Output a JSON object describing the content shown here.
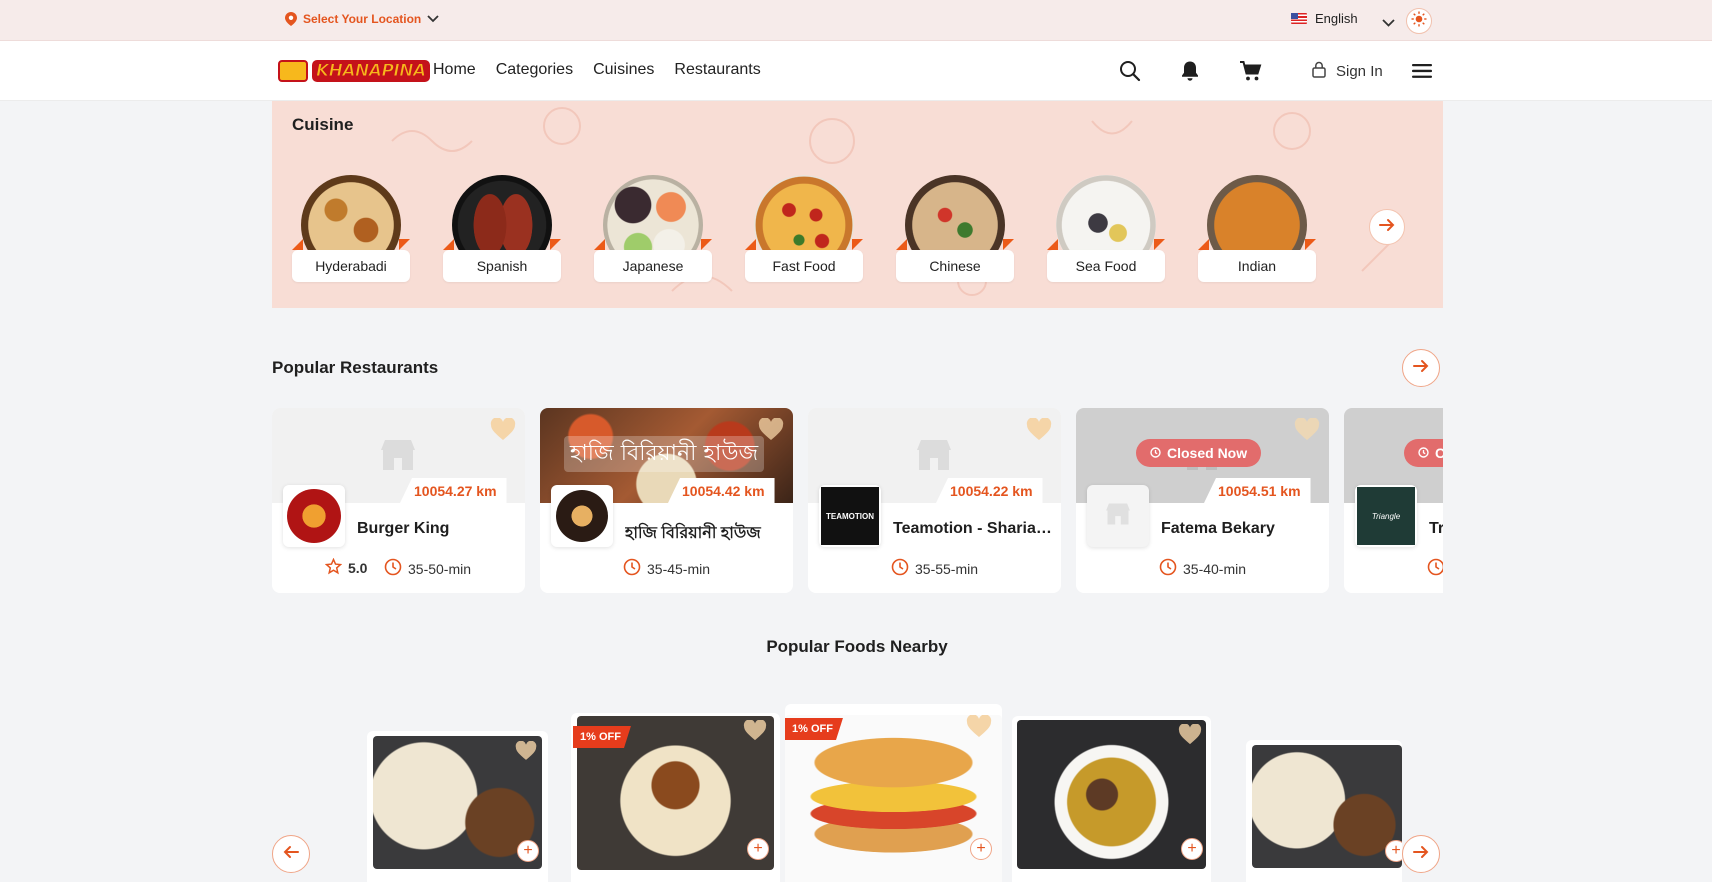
{
  "topbar": {
    "location_label": "Select Your Location",
    "language": "English"
  },
  "nav": {
    "links": [
      "Home",
      "Categories",
      "Cuisines",
      "Restaurants"
    ],
    "sign_in": "Sign In"
  },
  "cuisine": {
    "title": "Cuisine",
    "items": [
      {
        "label": "Hyderabadi"
      },
      {
        "label": "Spanish"
      },
      {
        "label": "Japanese"
      },
      {
        "label": "Fast Food"
      },
      {
        "label": "Chinese"
      },
      {
        "label": "Sea Food"
      },
      {
        "label": "Indian"
      }
    ]
  },
  "popular_restaurants": {
    "title": "Popular Restaurants",
    "items": [
      {
        "name": "Burger King",
        "distance": "10054.27 km",
        "rating": "5.0",
        "time": "35-50-min",
        "status": ""
      },
      {
        "name": "হাজি বিরিয়ানী হাউজ",
        "cover_text": "হাজি বিরিয়ানী হাউজ",
        "distance": "10054.42 km",
        "rating": "",
        "time": "35-45-min",
        "status": ""
      },
      {
        "name": "Teamotion - Shariat...",
        "distance": "10054.22 km",
        "rating": "",
        "time": "35-55-min",
        "status": ""
      },
      {
        "name": "Fatema Bekary",
        "distance": "10054.51 km",
        "rating": "",
        "time": "35-40-min",
        "status": "Closed Now"
      },
      {
        "name": "Tr",
        "distance": "",
        "rating": "",
        "time": "",
        "status": "C"
      }
    ]
  },
  "popular_foods": {
    "title": "Popular Foods Nearby",
    "items": [
      {
        "discount": ""
      },
      {
        "discount": "1% OFF"
      },
      {
        "discount": "1% OFF"
      },
      {
        "discount": ""
      },
      {
        "discount": ""
      }
    ]
  },
  "colors": {
    "accent": "#e4551f",
    "topbar_bg": "#f6ebea",
    "cuisine_bg": "#f8ddd5",
    "page_bg": "#f3f4f6",
    "closed_badge": "#e26c6c"
  },
  "icons": {
    "location": "map-pin-icon",
    "search": "search-icon",
    "bell": "bell-icon",
    "cart": "cart-icon",
    "lock": "lock-icon",
    "menu": "hamburger-icon",
    "theme": "sun-icon",
    "next": "arrow-right-icon",
    "prev": "arrow-left-icon",
    "heart": "heart-icon",
    "star": "star-icon",
    "clock": "clock-icon",
    "store": "store-icon"
  }
}
